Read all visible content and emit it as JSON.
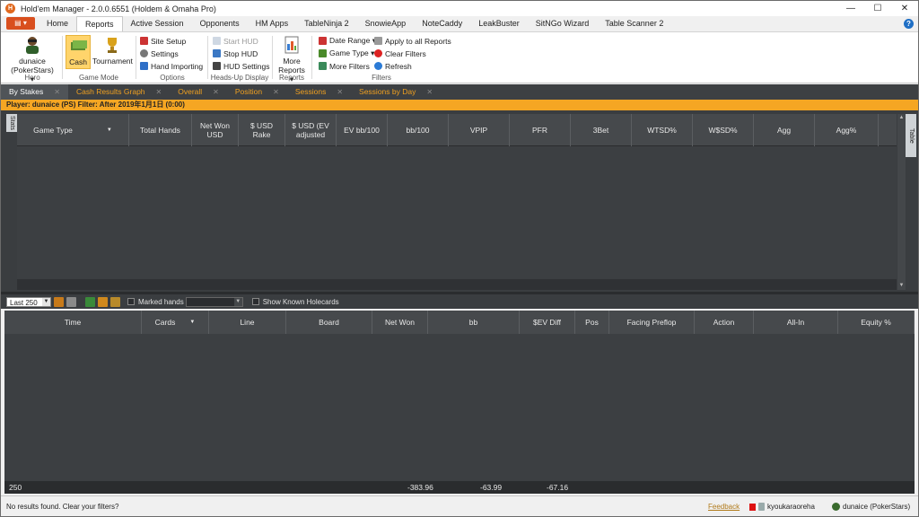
{
  "window": {
    "title": "Hold'em Manager - 2.0.0.6551 (Holdem & Omaha Pro)",
    "buttons": [
      "—",
      "☐",
      "✕"
    ]
  },
  "menu": {
    "tabs": [
      "Home",
      "Reports",
      "Active Session",
      "Opponents",
      "HM Apps",
      "TableNinja 2",
      "SnowieApp",
      "NoteCaddy",
      "LeakBuster",
      "SitNGo Wizard",
      "Table Scanner 2"
    ],
    "active": "Reports"
  },
  "ribbon": {
    "hero": {
      "name": "dunaice",
      "site": "(PokerStars) ▾",
      "group": "Hero"
    },
    "game_mode": {
      "cash": "Cash",
      "tournament": "Tournament",
      "group": "Game Mode"
    },
    "options": {
      "site_setup": "Site Setup",
      "settings": "Settings",
      "hand_importing": "Hand Importing",
      "group": "Options"
    },
    "hud": {
      "start": "Start HUD",
      "stop": "Stop HUD",
      "settings": "HUD Settings",
      "group": "Heads-Up Display"
    },
    "reports": {
      "more": "More",
      "reports": "Reports ▾",
      "group": "Reports"
    },
    "filters": {
      "date_range": "Date Range ▾",
      "game_type": "Game Type ▾",
      "more_filters": "More Filters",
      "apply_all": "Apply to all Reports",
      "clear": "Clear Filters",
      "refresh": "Refresh",
      "group": "Filters"
    }
  },
  "report_tabs": [
    "By Stakes",
    "Cash Results Graph",
    "Overall",
    "Position",
    "Sessions",
    "Sessions by Day"
  ],
  "filter_bar": "Player: dunaice (PS)   Filter: After 2019年1月1日 (0:00)",
  "stats_side": "Stats",
  "table_side": "Table",
  "top_grid_columns": [
    {
      "label": "Game Type",
      "w": 125
    },
    {
      "label": "Total Hands",
      "w": 70
    },
    {
      "label": "Net Won USD",
      "w": 52
    },
    {
      "label": "$ USD Rake",
      "w": 52
    },
    {
      "label": "$ USD (EV adjusted",
      "w": 57
    },
    {
      "label": "EV bb/100",
      "w": 57
    },
    {
      "label": "bb/100",
      "w": 68
    },
    {
      "label": "VPIP",
      "w": 68
    },
    {
      "label": "PFR",
      "w": 68
    },
    {
      "label": "3Bet",
      "w": 68
    },
    {
      "label": "WTSD%",
      "w": 68
    },
    {
      "label": "W$SD%",
      "w": 68
    },
    {
      "label": "Agg",
      "w": 68
    },
    {
      "label": "Agg%",
      "w": 71
    }
  ],
  "hands_toolbar": {
    "limit": "Last 250",
    "marked_hands": "Marked hands",
    "show_known_holecards": "Show Known Holecards"
  },
  "bottom_grid_columns": [
    {
      "label": "Time",
      "w": 153
    },
    {
      "label": "Cards",
      "w": 75
    },
    {
      "label": "Line",
      "w": 86
    },
    {
      "label": "Board",
      "w": 96
    },
    {
      "label": "Net Won",
      "w": 62
    },
    {
      "label": "bb",
      "w": 102
    },
    {
      "label": "$EV Diff",
      "w": 62
    },
    {
      "label": "Pos",
      "w": 38
    },
    {
      "label": "Facing Preflop",
      "w": 95
    },
    {
      "label": "Action",
      "w": 66
    },
    {
      "label": "All-In",
      "w": 94
    },
    {
      "label": "Equity %",
      "w": 85
    }
  ],
  "totals": {
    "count": "250",
    "net_won": "-383.96",
    "bb": "-63.99",
    "ev_diff": "-67.16"
  },
  "status": {
    "message": "No results found.  Clear your filters?",
    "feedback": "Feedback",
    "database": "kyoukaraoreha",
    "player": "dunaice (PokerStars)"
  }
}
